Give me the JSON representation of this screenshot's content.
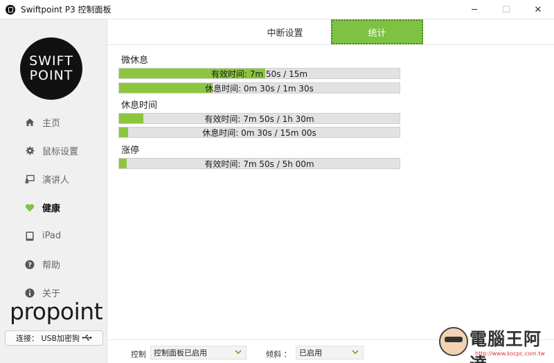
{
  "window": {
    "title": "Swiftpoint P3 控制面板",
    "minimize": "─",
    "maximize": "☐",
    "close": "✕"
  },
  "sidebar": {
    "logo_line1": "SWIFT",
    "logo_line2": "POINT",
    "items": [
      {
        "label": "主页",
        "icon": "home-icon"
      },
      {
        "label": "鼠标设置",
        "icon": "gear-icon"
      },
      {
        "label": "演讲人",
        "icon": "presenter-icon"
      },
      {
        "label": "健康",
        "icon": "heart-icon"
      },
      {
        "label": "iPad",
        "icon": "tablet-icon"
      },
      {
        "label": "帮助",
        "icon": "help-icon"
      },
      {
        "label": "关于",
        "icon": "info-icon"
      }
    ],
    "active_item": "健康",
    "brand": "propoint",
    "connection": "连接： USB加密狗",
    "connection_icon": "usb-icon"
  },
  "tabs": [
    {
      "label": "中断设置",
      "active": false
    },
    {
      "label": "统计",
      "active": true
    }
  ],
  "stats": {
    "micro_break": {
      "title": "微休息",
      "bars": [
        {
          "label": "有效时间: 7m 50s / 15m",
          "fraction": 0.522
        },
        {
          "label": "休息时间: 0m 30s / 1m 30s",
          "fraction": 0.333
        }
      ]
    },
    "rest_break": {
      "title": "休息时间",
      "bars": [
        {
          "label": "有效时间: 7m 50s / 1h 30m",
          "fraction": 0.087
        },
        {
          "label": "休息时间: 0m 30s / 15m 00s",
          "fraction": 0.033
        }
      ]
    },
    "suspend": {
      "title": "涨停",
      "bars": [
        {
          "label": "有效时间: 7m 50s / 5h 00m",
          "fraction": 0.026
        }
      ]
    }
  },
  "footer": {
    "control_label": "控制",
    "control_value": "控制面板已启用",
    "tilt_label": "倾斜 ：",
    "tilt_value": "已启用"
  },
  "watermark": {
    "text": "電腦王阿達",
    "url": "http://www.kocpc.com.tw"
  },
  "colors": {
    "accent": "#7dc242",
    "bar_fill": "#8cc63f",
    "bar_bg": "#e2e2e2"
  }
}
